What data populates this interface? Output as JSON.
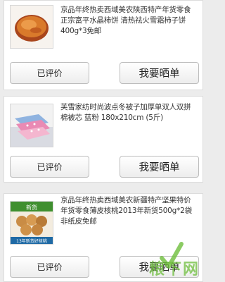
{
  "orders": [
    {
      "title": "京品年终热卖西域美农陕西特产年货零食 正宗富平水晶柿饼 清热祛火雪霜柿子饼400g*3免邮",
      "rated_label": "已评价",
      "show_label": "我要晒单",
      "image": "persimmon-cake-thumbnail"
    },
    {
      "title": "芙雪家纺时尚波点冬被子加厚单双人双拼棉被芯 蓝粉 180x210cm (5斤)",
      "rated_label": "已评价",
      "show_label": "我要晒单",
      "image": "quilt-thumbnail"
    },
    {
      "title": "京品年终热卖西域美农新疆特产坚果特价年货零食薄皮核桃2013年新货500g*2袋非纸皮免邮",
      "rated_label": "已评价",
      "show_label": "我要晒单",
      "image": "walnut-thumbnail",
      "thumb_badge": "新货",
      "thumb_caption": "13年新货好核桃"
    }
  ],
  "watermark": {
    "text": "粮下网",
    "color": "#6ebe3c"
  }
}
